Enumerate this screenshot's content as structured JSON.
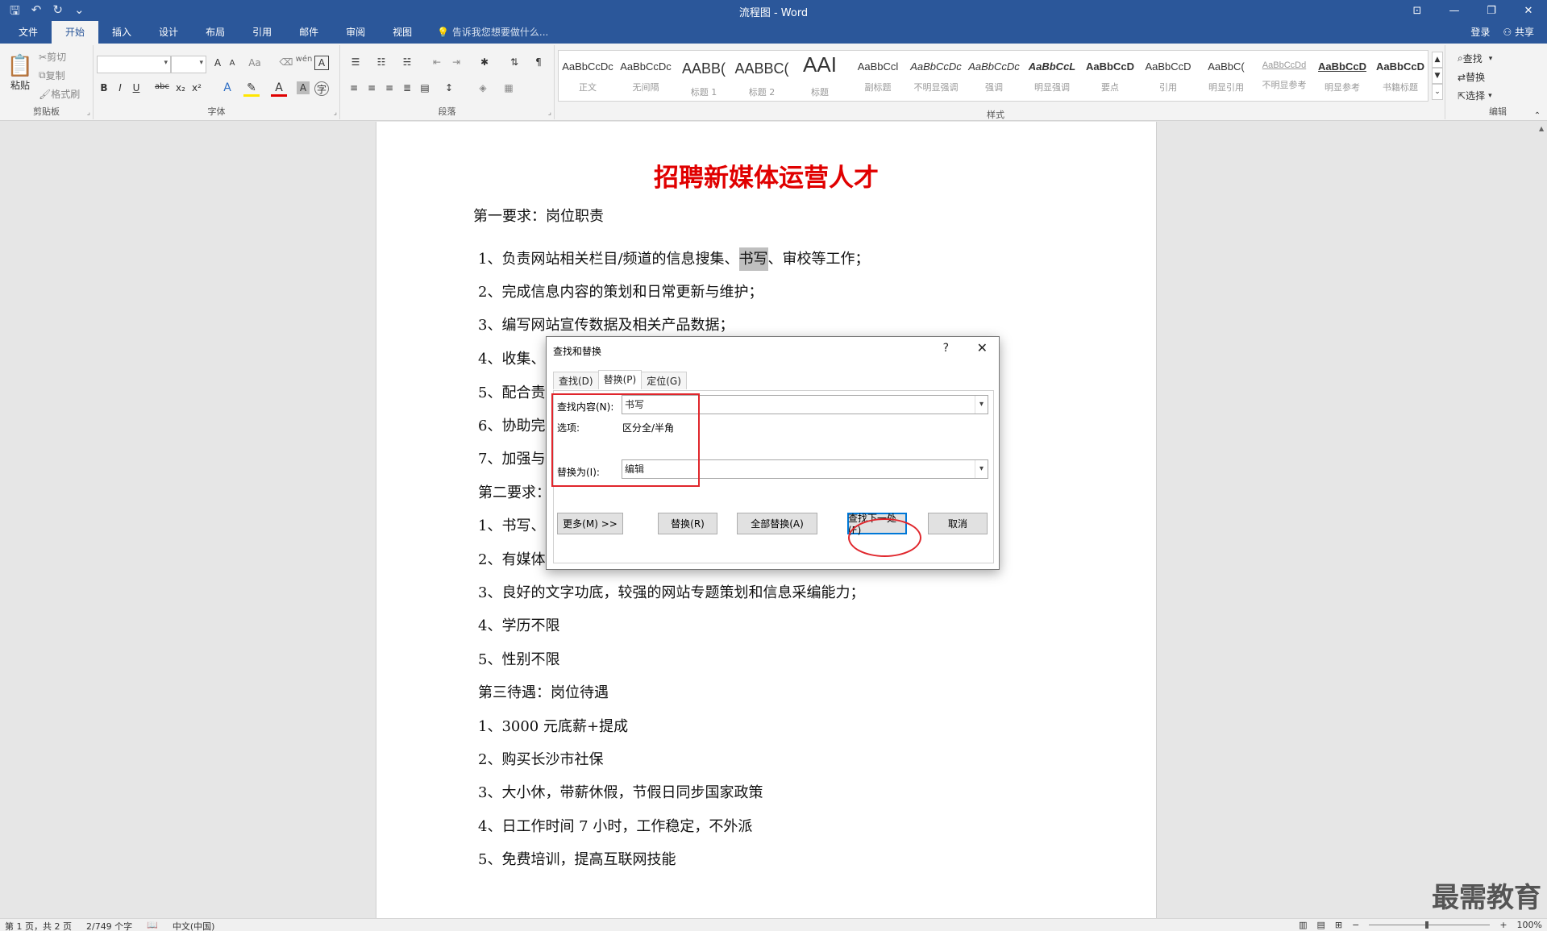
{
  "window": {
    "title": "流程图 - Word"
  },
  "tabs": [
    "文件",
    "开始",
    "插入",
    "设计",
    "布局",
    "引用",
    "邮件",
    "审阅",
    "视图"
  ],
  "active_tab": "开始",
  "tell_me": "告诉我您想要做什么...",
  "account": {
    "login": "登录",
    "share": "共享"
  },
  "ribbon": {
    "clipboard": {
      "label": "剪贴板",
      "paste": "粘贴",
      "cut": "剪切",
      "copy": "复制",
      "format_painter": "格式刷"
    },
    "font": {
      "label": "字体",
      "bold": "B",
      "italic": "I",
      "underline": "U",
      "strike": "abc",
      "sub": "x₂",
      "sup": "x²",
      "grow": "A",
      "shrink": "A",
      "case": "Aa"
    },
    "paragraph": {
      "label": "段落"
    },
    "styles": {
      "label": "样式",
      "items": [
        {
          "preview": "AaBbCcDc",
          "name": "正文"
        },
        {
          "preview": "AaBbCcDc",
          "name": "无间隔"
        },
        {
          "preview": "AABB(",
          "name": "标题 1"
        },
        {
          "preview": "AABBC(",
          "name": "标题 2"
        },
        {
          "preview": "AAI",
          "name": "标题"
        },
        {
          "preview": "AaBbCcl",
          "name": "副标题"
        },
        {
          "preview": "AaBbCcDc",
          "name": "不明显强调"
        },
        {
          "preview": "AaBbCcDc",
          "name": "强调"
        },
        {
          "preview": "AaBbCcL",
          "name": "明显强调"
        },
        {
          "preview": "AaBbCcD",
          "name": "要点"
        },
        {
          "preview": "AaBbCcD",
          "name": "引用"
        },
        {
          "preview": "AaBbC(",
          "name": "明显引用"
        },
        {
          "preview": "AaBbCcDd",
          "name": "不明显参考"
        },
        {
          "preview": "AaBbCcD",
          "name": "明显参考"
        },
        {
          "preview": "AaBbCcD",
          "name": "书籍标题"
        }
      ]
    },
    "editing": {
      "label": "编辑",
      "find": "查找",
      "replace": "替换",
      "select": "选择"
    }
  },
  "document": {
    "title": "招聘新媒体运营人才",
    "heading1": "第一要求：岗位职责",
    "l1_pre": "1、负责网站相关栏目/频道的信息搜集、",
    "l1_hl": "书写",
    "l1_post": "、审校等工作；",
    "l2": "2、完成信息内容的策划和日常更新与维护；",
    "l3": "3、编写网站宣传数据及相关产品数据；",
    "l4": "4、收集、",
    "l5": "5、配合责",
    "l6": "6、协助完",
    "l7": "7、加强与",
    "heading2": "第二要求：",
    "m1": "1、书写、",
    "m2": "2、有媒体",
    "m3": "3、良好的文字功底，较强的网站专题策划和信息采编能力；",
    "m4": "4、学历不限",
    "m5": "5、性别不限",
    "heading3": "第三待遇：岗位待遇",
    "n1": "1、3000 元底薪+提成",
    "n2": "2、购买长沙市社保",
    "n3": "3、大小休，带薪休假，节假日同步国家政策",
    "n4": "4、日工作时间 7 小时，工作稳定，不外派",
    "n5": "5、免费培训，提高互联网技能"
  },
  "dialog": {
    "title": "查找和替换",
    "help": "?",
    "tabs": [
      "查找(D)",
      "替换(P)",
      "定位(G)"
    ],
    "active_tab": "替换(P)",
    "find_label": "查找内容(N):",
    "find_value": "书写",
    "options_label": "选项:",
    "options_value": "区分全/半角",
    "replace_label": "替换为(I):",
    "replace_value": "编辑",
    "buttons": {
      "more": "更多(M) >>",
      "replace": "替换(R)",
      "replace_all": "全部替换(A)",
      "find_next": "查找下一处(F)",
      "cancel": "取消"
    }
  },
  "status": {
    "page": "第 1 页，共 2 页",
    "words": "2/749 个字",
    "lang": "中文(中国)",
    "zoom": "100%"
  },
  "watermark": "最需教育",
  "colors": {
    "ribbon_blue": "#2b579a",
    "title_red": "#e00000",
    "annotation_red": "#e0262c"
  }
}
